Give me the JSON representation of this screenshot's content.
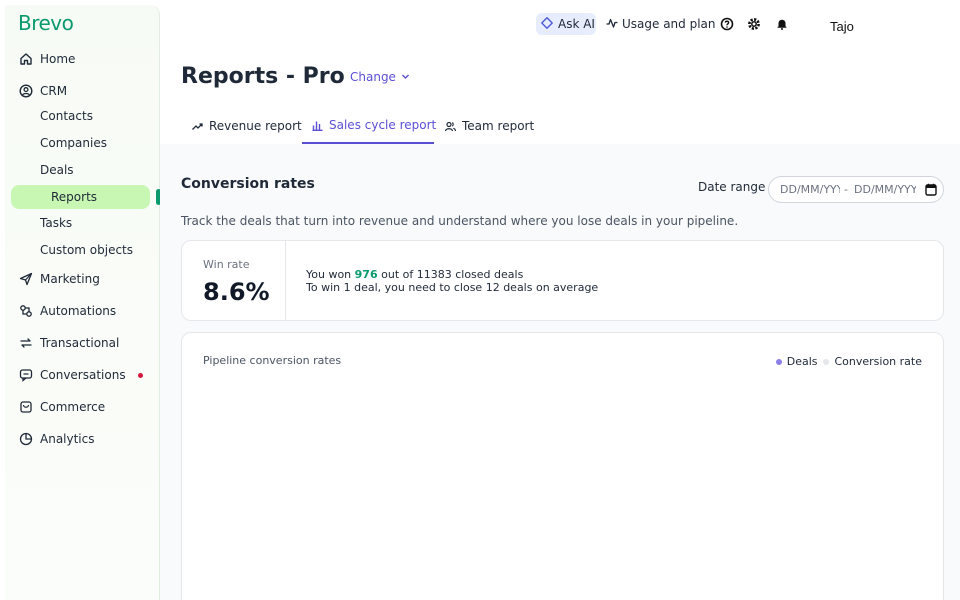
{
  "brand": {
    "logo": "Brevo",
    "accent": "#0b996e"
  },
  "sidebar": {
    "items": [
      {
        "label": "Home",
        "icon": "home-icon"
      },
      {
        "label": "CRM",
        "icon": "crm-icon"
      },
      {
        "label": "Marketing",
        "icon": "send-icon"
      },
      {
        "label": "Automations",
        "icon": "automation-icon"
      },
      {
        "label": "Transactional",
        "icon": "transactional-icon"
      },
      {
        "label": "Conversations",
        "icon": "chat-icon"
      },
      {
        "label": "Commerce",
        "icon": "bag-icon"
      },
      {
        "label": "Analytics",
        "icon": "pie-chart-icon"
      }
    ],
    "crm_sub": [
      "Contacts",
      "Companies",
      "Deals",
      "Reports",
      "Tasks",
      "Custom objects"
    ],
    "active_sub": "Reports"
  },
  "topbar": {
    "ask_ai": "Ask AI",
    "usage": "Usage and plan",
    "user": "Tajo"
  },
  "header": {
    "title": "Reports - Pro",
    "change": "Change"
  },
  "tabs": [
    {
      "label": "Revenue report",
      "active": false
    },
    {
      "label": "Sales cycle report",
      "active": true
    },
    {
      "label": "Team report",
      "active": false
    }
  ],
  "section": {
    "title": "Conversion rates",
    "date_label": "Date range",
    "date_from_placeholder": "DD/MM/YYYY",
    "date_separator": "-",
    "date_to_placeholder": "DD/MM/YYYY",
    "description": "Track the deals that turn into revenue and understand where you lose deals in your pipeline."
  },
  "win_rate": {
    "label": "Win rate",
    "value": "8.6%",
    "line1_prefix": "You won ",
    "won": "976",
    "line1_suffix": " out of 11383 closed deals",
    "line2": "To win 1 deal, you need to close 12 deals on average"
  },
  "pipeline": {
    "title": "Pipeline conversion rates",
    "legend": [
      {
        "label": "Deals",
        "color": "#8b7fe8"
      },
      {
        "label": "Conversion rate",
        "color": "#e5e7eb"
      }
    ]
  }
}
